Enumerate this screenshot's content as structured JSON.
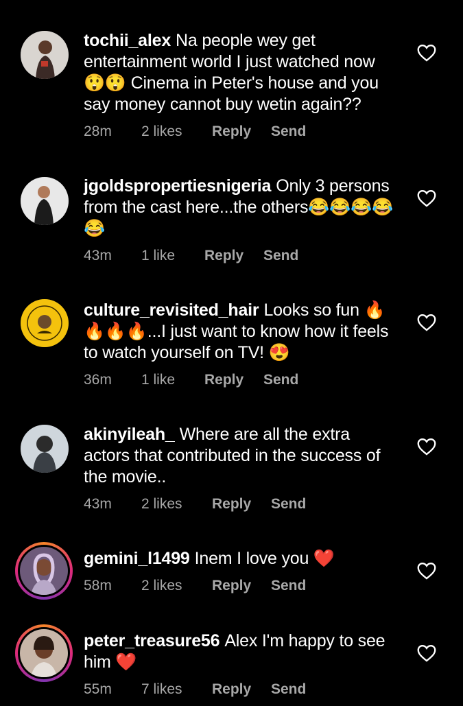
{
  "comments": [
    {
      "username": "tochii_alex",
      "text": "Na people wey get entertainment world I just watched now 😲😲 Cinema in Peter's house and you say money cannot buy wetin again??",
      "time": "28m",
      "likes": "2 likes",
      "reply": "Reply",
      "send": "Send"
    },
    {
      "username": "jgoldspropertiesnigeria",
      "text": "Only 3 persons from the cast here...the others😂😂😂😂😂",
      "time": "43m",
      "likes": "1 like",
      "reply": "Reply",
      "send": "Send"
    },
    {
      "username": "culture_revisited_hair",
      "text": "Looks so fun 🔥🔥🔥🔥...I just want to know how it feels to watch yourself on TV! 😍",
      "time": "36m",
      "likes": "1 like",
      "reply": "Reply",
      "send": "Send"
    },
    {
      "username": "akinyileah_",
      "text": "Where are all the extra actors that contributed in the success of the movie..",
      "time": "43m",
      "likes": "2 likes",
      "reply": "Reply",
      "send": "Send"
    },
    {
      "username": "gemini_l1499",
      "text": "Inem I love you ❤️",
      "time": "58m",
      "likes": "2 likes",
      "reply": "Reply",
      "send": "Send"
    },
    {
      "username": "peter_treasure56",
      "text": "Alex I'm happy to see him ❤️",
      "time": "55m",
      "likes": "7 likes",
      "reply": "Reply",
      "send": "Send"
    }
  ],
  "icons": {
    "like": "heart-outline-icon"
  },
  "colors": {
    "background": "#000000",
    "text": "#ffffff",
    "meta": "#a8a8a8",
    "story_ring_start": "#f58529",
    "story_ring_end": "#8134af"
  }
}
